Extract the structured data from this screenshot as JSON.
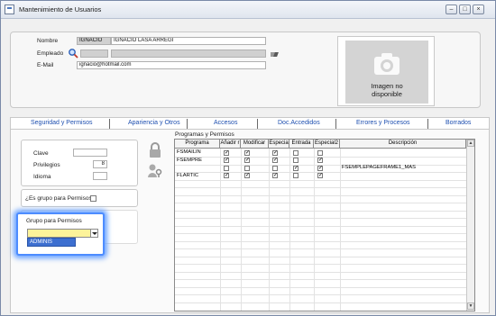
{
  "window": {
    "title": "Mantenimiento de Usuarios"
  },
  "header": {
    "nombre_label": "Nombre",
    "nombre_code": "IGNACIO",
    "nombre_full": "IGNACIO LASA ARREGI",
    "empleado_label": "Empleado",
    "email_label": "E-Mail",
    "email_value": "ignacio@hotmail.com",
    "photo_text_line1": "Imagen no",
    "photo_text_line2": "disponible"
  },
  "tabs": [
    {
      "label": "Seguridad y Permisos"
    },
    {
      "label": "Apariencia y Otros"
    },
    {
      "label": "Accesos"
    },
    {
      "label": "Doc.Accedidos"
    },
    {
      "label": "Errores y Procesos"
    },
    {
      "label": "Borrados"
    }
  ],
  "security": {
    "clave_label": "Clave",
    "clave_value": "",
    "privilegios_label": "Privilegios",
    "privilegios_value": "8",
    "idioma_label": "Idioma",
    "idioma_value": "",
    "group_question": "¿Es grupo para Permisos?",
    "group_perm_label": "Grupo para Permisos",
    "dropdown_value": "",
    "dropdown_option": "ADMINIS"
  },
  "grid": {
    "title": "Programas y Permisos",
    "columns": [
      "Programa",
      "Añadir r",
      "Modificar",
      "Especia",
      "Entrada",
      "Especial2",
      "Descripción"
    ],
    "rows": [
      {
        "programa": "FSMAILIN",
        "checks": [
          true,
          true,
          true,
          false,
          false
        ],
        "descripcion": ""
      },
      {
        "programa": "FSEMPRE",
        "checks": [
          true,
          true,
          true,
          false,
          true
        ],
        "descripcion": ""
      },
      {
        "programa": "",
        "checks": [
          false,
          false,
          false,
          true,
          true
        ],
        "descripcion": "FSEMPLEPAGEFRAME1_MAS"
      },
      {
        "programa": "FLARTIC",
        "checks": [
          true,
          true,
          true,
          false,
          true
        ],
        "descripcion": ""
      }
    ]
  }
}
